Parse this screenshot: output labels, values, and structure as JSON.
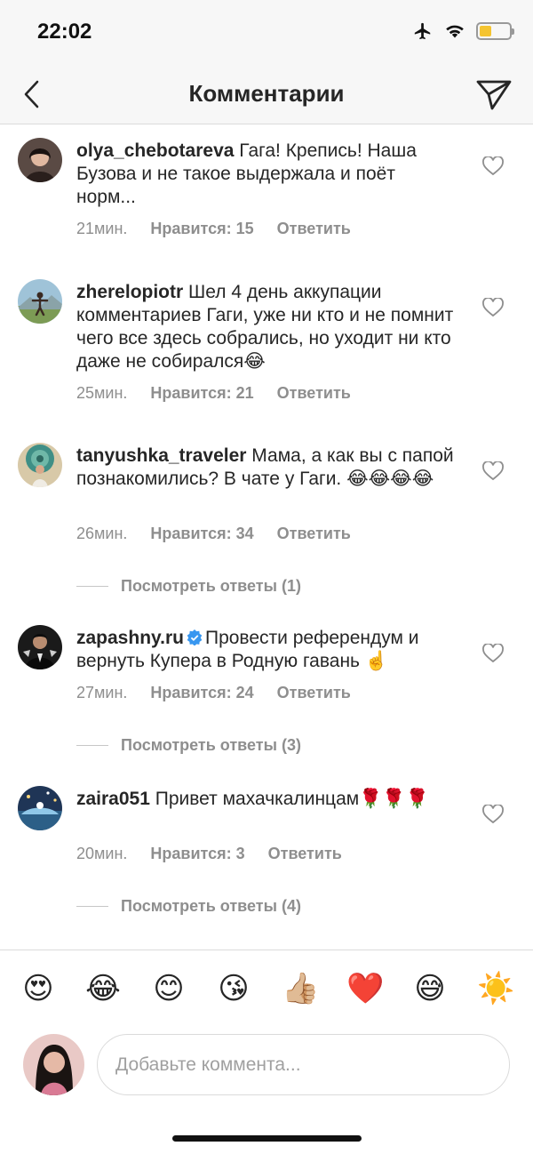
{
  "status_bar": {
    "time": "22:02",
    "battery_level": 0.4
  },
  "nav": {
    "title": "Комментарии"
  },
  "comments": [
    {
      "username": "olya_chebotareva",
      "text": "Гага! Крепись! Наша Бузова и не такое выдержала и поёт норм...",
      "time": "21мин.",
      "likes": "Нравится: 15",
      "reply": "Ответить"
    },
    {
      "username": "zherelopiotr",
      "text": "Шел 4 день аккупации комментариев Гаги, уже ни кто и не помнит чего все здесь собрались, но уходит ни кто даже не собирался😂",
      "time": "25мин.",
      "likes": "Нравится: 21",
      "reply": "Ответить"
    },
    {
      "username": "tanyushka_traveler",
      "text": "Мама, а как вы с папой познакомились? В чате у Гаги. 😂😂😂😂",
      "time": "26мин.",
      "likes": "Нравится: 34",
      "reply": "Ответить",
      "view_replies": "Посмотреть ответы (1)"
    },
    {
      "username": "zapashny.ru",
      "verified": true,
      "text": "Провести референдум и вернуть Купера в Родную гавань ☝️",
      "time": "27мин.",
      "likes": "Нравится: 24",
      "reply": "Ответить",
      "view_replies": "Посмотреть ответы (3)"
    },
    {
      "username": "zaira051",
      "text": "Привет махачкалинцам🌹🌹🌹",
      "time": "20мин.",
      "likes": "Нравится: 3",
      "reply": "Ответить",
      "view_replies": "Посмотреть ответы (4)"
    }
  ],
  "emoji_bar": [
    "😍",
    "😂",
    "😊",
    "😘",
    "👍🏼",
    "❤️",
    "😅",
    "☀️"
  ],
  "composer": {
    "placeholder": "Добавьте коммента...",
    "value": ""
  },
  "icons": {
    "back": "chevron-left-icon",
    "send": "paper-plane-icon",
    "like": "heart-outline-icon",
    "verified": "verified-badge-icon"
  },
  "colors": {
    "secondary_text": "#8e8e8e",
    "verified_blue": "#3897f0",
    "battery": "#f4c430"
  }
}
